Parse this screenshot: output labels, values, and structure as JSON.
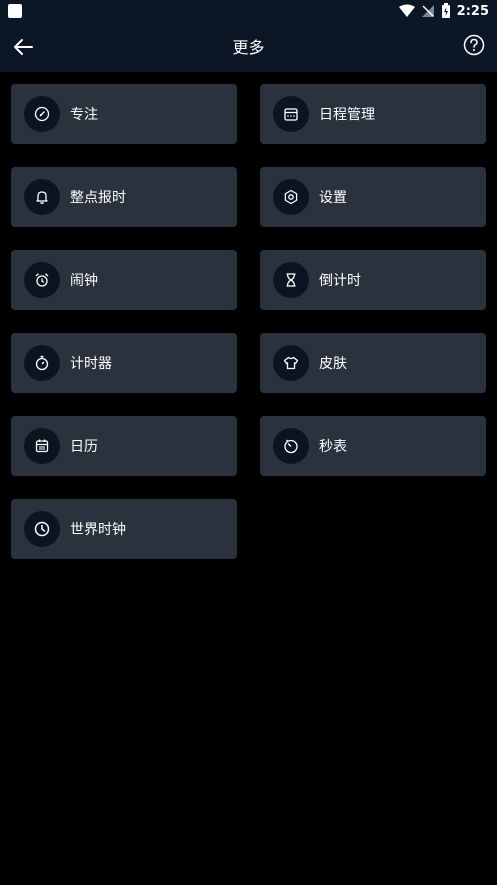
{
  "status_bar": {
    "time": "2:25"
  },
  "app_bar": {
    "title": "更多"
  },
  "items": [
    {
      "label": "专注",
      "icon": "focus-icon"
    },
    {
      "label": "日程管理",
      "icon": "schedule-icon"
    },
    {
      "label": "整点报时",
      "icon": "bell-icon"
    },
    {
      "label": "设置",
      "icon": "settings-icon"
    },
    {
      "label": "闹钟",
      "icon": "alarm-clock-icon"
    },
    {
      "label": "倒计时",
      "icon": "hourglass-icon"
    },
    {
      "label": "计时器",
      "icon": "timer-icon"
    },
    {
      "label": "皮肤",
      "icon": "shirt-icon"
    },
    {
      "label": "日历",
      "icon": "calendar-icon"
    },
    {
      "label": "秒表",
      "icon": "stopwatch-icon"
    },
    {
      "label": "世界时钟",
      "icon": "world-clock-icon"
    }
  ]
}
